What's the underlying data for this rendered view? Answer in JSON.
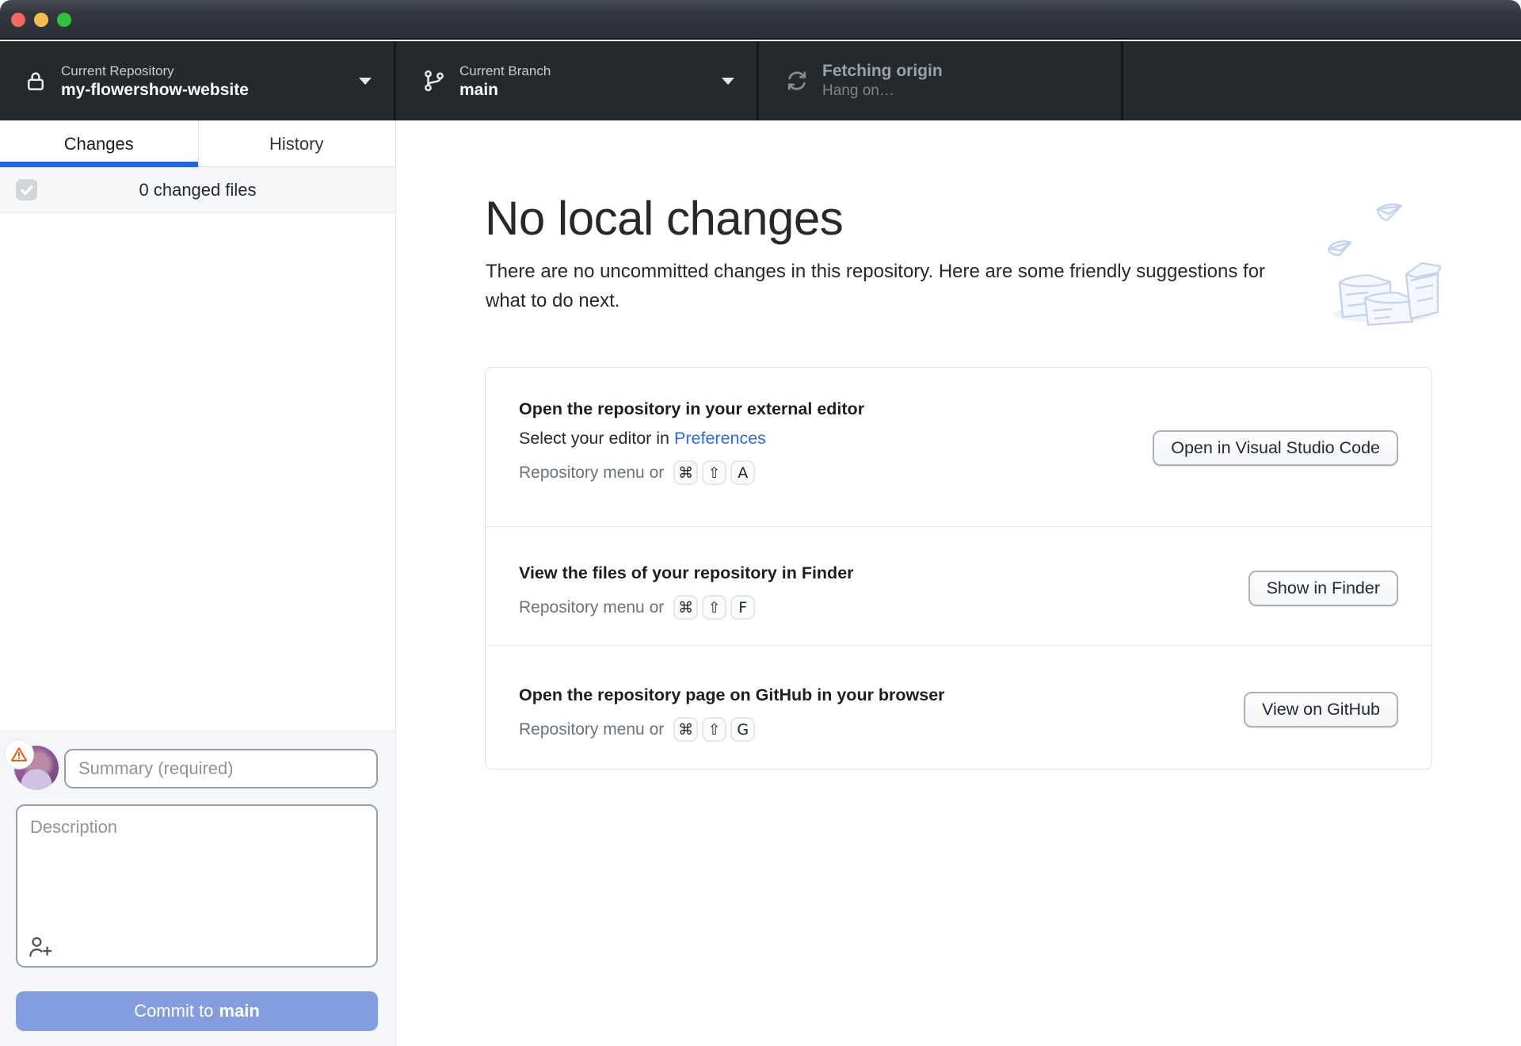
{
  "window": {
    "traffic_lights": [
      "close",
      "minimize",
      "zoom"
    ]
  },
  "toolbar": {
    "repository": {
      "label": "Current Repository",
      "value": "my-flowershow-website"
    },
    "branch": {
      "label": "Current Branch",
      "value": "main"
    },
    "fetch": {
      "label": "Fetching origin",
      "sublabel": "Hang on…"
    }
  },
  "sidebar": {
    "tabs": [
      {
        "label": "Changes",
        "active": true
      },
      {
        "label": "History",
        "active": false
      }
    ],
    "changed_files": "0 changed files",
    "commit": {
      "summary_placeholder": "Summary (required)",
      "description_placeholder": "Description",
      "button_prefix": "Commit to",
      "button_branch": "main"
    }
  },
  "main": {
    "title": "No local changes",
    "subtitle": "There are no uncommitted changes in this repository. Here are some friendly suggestions for what to do next.",
    "suggestions": [
      {
        "title": "Open the repository in your external editor",
        "line2_prefix": "Select your editor in",
        "line2_link": "Preferences",
        "shortcut_prefix": "Repository menu or",
        "keys": [
          "⌘",
          "⇧",
          "A"
        ],
        "button": "Open in Visual Studio Code"
      },
      {
        "title": "View the files of your repository in Finder",
        "shortcut_prefix": "Repository menu or",
        "keys": [
          "⌘",
          "⇧",
          "F"
        ],
        "button": "Show in Finder"
      },
      {
        "title": "Open the repository page on GitHub in your browser",
        "shortcut_prefix": "Repository menu or",
        "keys": [
          "⌘",
          "⇧",
          "G"
        ],
        "button": "View on GitHub"
      }
    ]
  },
  "icons": {
    "repository": "lock-icon",
    "branch": "git-branch-icon",
    "fetch": "sync-icon",
    "summary_status": "warning-triangle-icon",
    "coauthor": "person-add-icon",
    "empty_state": "paper-stack-illustration"
  },
  "colors": {
    "toolbar_bg": "#24292e",
    "active_tab_underline": "#2a63d9",
    "link_blue": "#2b6ce6",
    "commit_button_blue": "#839dde",
    "warning_orange": "#e8590c"
  }
}
